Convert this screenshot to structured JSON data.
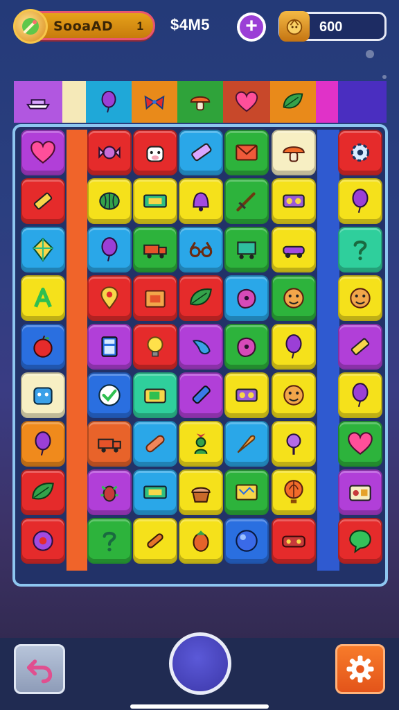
{
  "header": {
    "player_name": "SooaAD",
    "level": "1",
    "money": "$4M5",
    "coins": "600"
  },
  "shelf": [
    {
      "icon": "ship-icon",
      "color": "#b157e0"
    },
    {
      "icon": "empty-slot",
      "color": "#f5e9b8"
    },
    {
      "icon": "balloon-icon",
      "color": "#1fa8d8"
    },
    {
      "icon": "bow-icon",
      "color": "#e98a1a"
    },
    {
      "icon": "mushroom-icon",
      "color": "#2fa33a"
    },
    {
      "icon": "heart-icon",
      "color": "#c8482a"
    },
    {
      "icon": "leaf-icon",
      "color": "#e98a1a"
    },
    {
      "icon": "empty-slot",
      "color": "#e032c8"
    },
    {
      "icon": "empty-slot",
      "color": "#4a2ec0"
    }
  ],
  "board": {
    "rows": [
      [
        {
          "icon": "heart-icon",
          "color": "#b13fd8"
        },
        {
          "icon": "candy-icon",
          "color": "#e52b2b"
        },
        {
          "icon": "cow-icon",
          "color": "#e52b2b"
        },
        {
          "icon": "eraser-icon",
          "color": "#2aa7e8"
        },
        {
          "icon": "envelope-icon",
          "color": "#2db33c"
        },
        {
          "icon": "mushroom-icon",
          "color": "#f7efc3"
        },
        {
          "icon": "gear-icon",
          "color": "#e52b2b"
        }
      ],
      [
        {
          "icon": "pencil-icon",
          "color": "#e52b2b"
        },
        {
          "icon": "melon-icon",
          "color": "#f5e11b"
        },
        {
          "icon": "ticket-icon",
          "color": "#f5e11b"
        },
        {
          "icon": "bell-icon",
          "color": "#f5e11b"
        },
        {
          "icon": "sword-icon",
          "color": "#2db33c"
        },
        {
          "icon": "tape-icon",
          "color": "#f5e11b"
        },
        {
          "icon": "balloon-icon",
          "color": "#f5e11b"
        }
      ],
      [
        {
          "icon": "kite-icon",
          "color": "#2aa7e8"
        },
        {
          "icon": "balloon-icon",
          "color": "#2aa7e8"
        },
        {
          "icon": "truck-icon",
          "color": "#2db33c"
        },
        {
          "icon": "glasses-icon",
          "color": "#2aa7e8"
        },
        {
          "icon": "cart-icon",
          "color": "#2db33c"
        },
        {
          "icon": "car-icon",
          "color": "#f5e11b"
        },
        {
          "icon": "question-icon",
          "color": "#2fcf9c"
        }
      ],
      [
        {
          "icon": "letter-a-icon",
          "color": "#f5e11b"
        },
        {
          "icon": "pin-icon",
          "color": "#e52b2b"
        },
        {
          "icon": "box-icon",
          "color": "#e52b2b"
        },
        {
          "icon": "leaf-icon",
          "color": "#e52b2b"
        },
        {
          "icon": "blob-icon",
          "color": "#2aa7e8"
        },
        {
          "icon": "face-icon",
          "color": "#2db33c"
        },
        {
          "icon": "face-icon",
          "color": "#f5e11b"
        }
      ],
      [
        {
          "icon": "apple-icon",
          "color": "#2a6fe0"
        },
        {
          "icon": "calculator-icon",
          "color": "#b13fd8"
        },
        {
          "icon": "bulb-icon",
          "color": "#e52b2b"
        },
        {
          "icon": "horn-icon",
          "color": "#b13fd8"
        },
        {
          "icon": "blob-icon",
          "color": "#2db33c"
        },
        {
          "icon": "balloon-icon",
          "color": "#f5e11b"
        },
        {
          "icon": "pencil-icon",
          "color": "#b13fd8"
        }
      ],
      [
        {
          "icon": "robot-icon",
          "color": "#f7efc3"
        },
        {
          "icon": "check-icon",
          "color": "#2a6fe0"
        },
        {
          "icon": "camera-icon",
          "color": "#2fcf9c"
        },
        {
          "icon": "crayon-icon",
          "color": "#b13fd8"
        },
        {
          "icon": "tape-icon",
          "color": "#f5e11b"
        },
        {
          "icon": "face-icon",
          "color": "#f5e11b"
        },
        {
          "icon": "balloon-icon",
          "color": "#f5e11b"
        }
      ],
      [
        {
          "icon": "balloon-icon",
          "color": "#f08a1c"
        },
        {
          "icon": "truck-icon",
          "color": "#e8632a"
        },
        {
          "icon": "bandage-icon",
          "color": "#2aa7e8"
        },
        {
          "icon": "plant-icon",
          "color": "#f5e11b"
        },
        {
          "icon": "carrot-icon",
          "color": "#2aa7e8"
        },
        {
          "icon": "rattle-icon",
          "color": "#f5e11b"
        },
        {
          "icon": "heart-icon",
          "color": "#2db33c"
        }
      ],
      [
        {
          "icon": "leaf-icon",
          "color": "#e52b2b"
        },
        {
          "icon": "bug-icon",
          "color": "#b13fd8"
        },
        {
          "icon": "ticket-icon",
          "color": "#2aa7e8"
        },
        {
          "icon": "cupcake-icon",
          "color": "#f5e11b"
        },
        {
          "icon": "map-icon",
          "color": "#2db33c"
        },
        {
          "icon": "hot-air-balloon-icon",
          "color": "#f5e11b"
        },
        {
          "icon": "radio-icon",
          "color": "#b13fd8"
        }
      ],
      [
        {
          "icon": "donut-icon",
          "color": "#e52b2b"
        },
        {
          "icon": "question-icon",
          "color": "#2db33c"
        },
        {
          "icon": "bone-icon",
          "color": "#f5e11b"
        },
        {
          "icon": "acorn-icon",
          "color": "#f5e11b"
        },
        {
          "icon": "orb-icon",
          "color": "#2a6fe0"
        },
        {
          "icon": "toy-car-icon",
          "color": "#e52b2b"
        },
        {
          "icon": "speech-icon",
          "color": "#e52b2b"
        }
      ]
    ]
  },
  "controls": {
    "undo_icon": "undo-icon",
    "shuffle_icon": "shuffle-orb",
    "settings_icon": "gear-icon"
  }
}
